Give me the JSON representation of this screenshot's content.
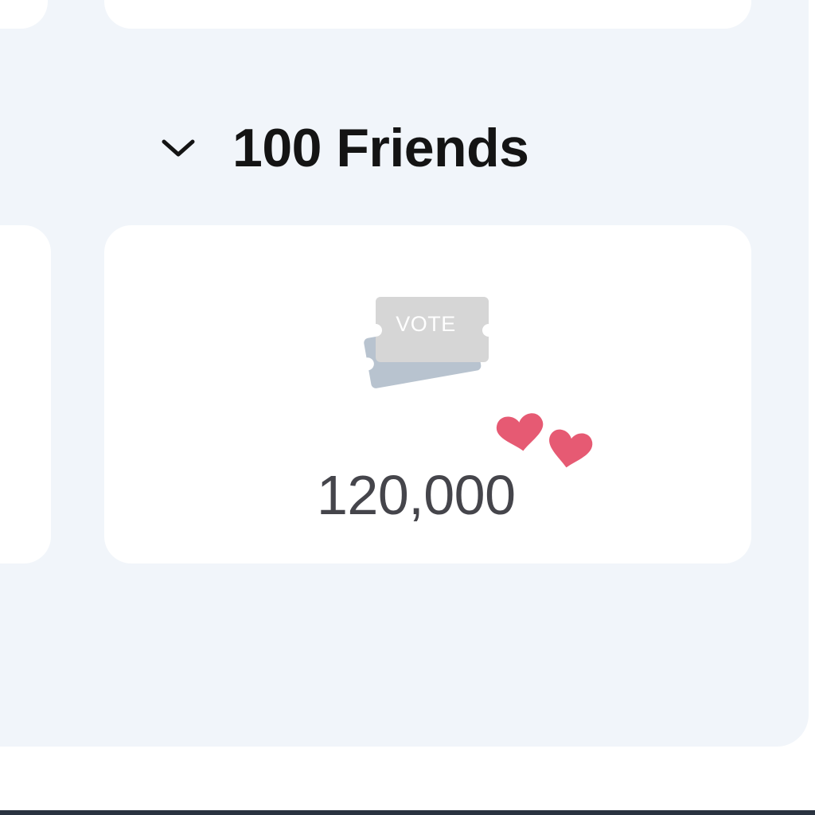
{
  "section": {
    "title": "100 Friends",
    "toggle_icon": "chevron-down-icon"
  },
  "reward": {
    "ticket_label": "VOTE",
    "ticket_icon": "vote-ticket-icon",
    "hearts_icon": "hearts-icon",
    "amount": "120,000"
  },
  "colors": {
    "background": "#f1f5fa",
    "card": "#ffffff",
    "title": "#141414",
    "amount": "#45454b",
    "ticket_front": "#d6d6d6",
    "ticket_back": "#b8c3cf",
    "heart": "#e65a73"
  }
}
